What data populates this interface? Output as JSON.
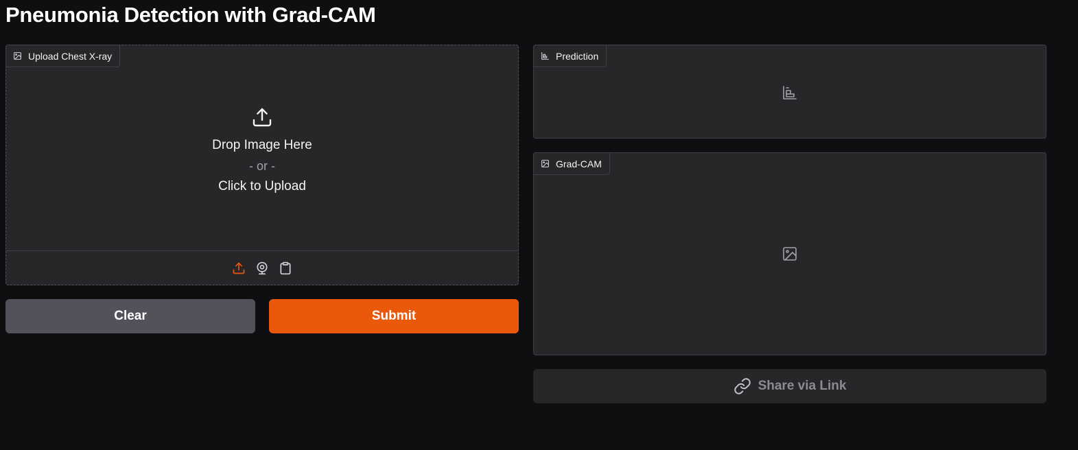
{
  "page": {
    "title": "Pneumonia Detection with Grad-CAM"
  },
  "input_panel": {
    "label": "Upload Chest X-ray",
    "label_icon": "image-icon",
    "drop_text": "Drop Image Here",
    "or_text": "- or -",
    "click_text": "Click to Upload",
    "sources": [
      {
        "name": "upload-source",
        "icon": "upload-icon",
        "active": true
      },
      {
        "name": "webcam-source",
        "icon": "webcam-icon",
        "active": false
      },
      {
        "name": "clipboard-source",
        "icon": "clipboard-icon",
        "active": false
      }
    ]
  },
  "actions": {
    "clear_label": "Clear",
    "submit_label": "Submit"
  },
  "prediction_panel": {
    "label": "Prediction",
    "label_icon": "bar-chart-icon",
    "placeholder_icon": "bar-chart-icon"
  },
  "gradcam_panel": {
    "label": "Grad-CAM",
    "label_icon": "image-icon",
    "placeholder_icon": "image-icon"
  },
  "share": {
    "label": "Share via Link",
    "icon": "link-icon"
  },
  "colors": {
    "background": "#0f0f11",
    "panel": "#27272a",
    "accent": "#ea580c",
    "secondary_button": "#52525b"
  }
}
